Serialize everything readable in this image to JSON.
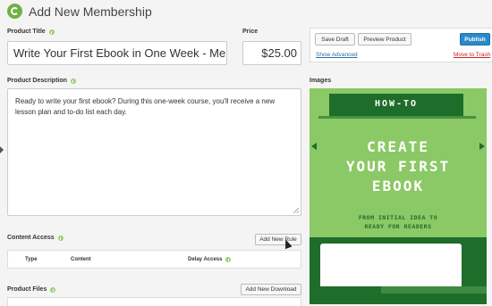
{
  "header": {
    "title": "Add New Membership"
  },
  "product_title": {
    "label": "Product Title",
    "value": "Write Your First Ebook in One Week - Mer"
  },
  "price": {
    "label": "Price",
    "value": "$25.00"
  },
  "description": {
    "label": "Product Description",
    "value": "Ready to write your first ebook? During this one-week course, you'll receive a new lesson plan and to-do list each day."
  },
  "publish": {
    "save_draft": "Save Draft",
    "preview": "Preview Product",
    "publish": "Publish",
    "show_advanced": "Show Advanced",
    "move_to_trash": "Move to Trash"
  },
  "images": {
    "label": "Images",
    "cover_line1": "HOW-TO",
    "cover_line2": "CREATE",
    "cover_line3": "YOUR FIRST",
    "cover_line4": "EBOOK",
    "cover_sub1": "FROM INITIAL IDEA TO",
    "cover_sub2": "READY FOR READERS"
  },
  "content_access": {
    "label": "Content Access",
    "add_rule": "Add New Rule",
    "columns": [
      "Type",
      "Content",
      "Delay Access"
    ]
  },
  "product_files": {
    "label": "Product Files",
    "add_download": "Add New Download"
  },
  "colors": {
    "brand_green": "#6fb143",
    "publish_blue": "#2a8ac9",
    "trash_red": "#d0201f",
    "link_blue": "#2b6ca3",
    "cover_green": "#8bc866",
    "cover_dark": "#1e6d2a"
  }
}
